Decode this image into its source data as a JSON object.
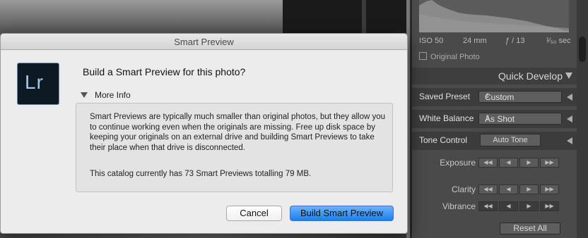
{
  "dialog": {
    "title": "Smart Preview",
    "icon_text": "Lr",
    "heading": "Build a Smart Preview for this photo?",
    "disclosure_label": "More Info",
    "info_paragraph_1": "Smart Previews are typically much smaller than original photos, but they allow you to continue working even when the originals are missing. Free up disk space by keeping your originals on an external drive and building Smart Previews to take their place when that drive is disconnected.",
    "info_paragraph_2": "This catalog currently has 73 Smart Previews totalling 79 MB.",
    "cancel_label": "Cancel",
    "build_label": "Build Smart Preview"
  },
  "histogram": {
    "iso": "ISO 50",
    "focal": "24 mm",
    "aperture": "ƒ / 13",
    "shutter": "¹⁄₅₀ sec"
  },
  "original_photo_label": "Original Photo",
  "quick_develop": {
    "title": "Quick Develop",
    "saved_preset_label": "Saved Preset",
    "saved_preset_value": "Custom",
    "white_balance_label": "White Balance",
    "white_balance_value": "As Shot",
    "tone_control_label": "Tone Control",
    "auto_tone_label": "Auto Tone",
    "exposure_label": "Exposure",
    "clarity_label": "Clarity",
    "vibrance_label": "Vibrance",
    "reset_label": "Reset All"
  },
  "colors": {
    "annotation_arrow": "#e8452c",
    "primary_button": "#1b7ff2"
  }
}
